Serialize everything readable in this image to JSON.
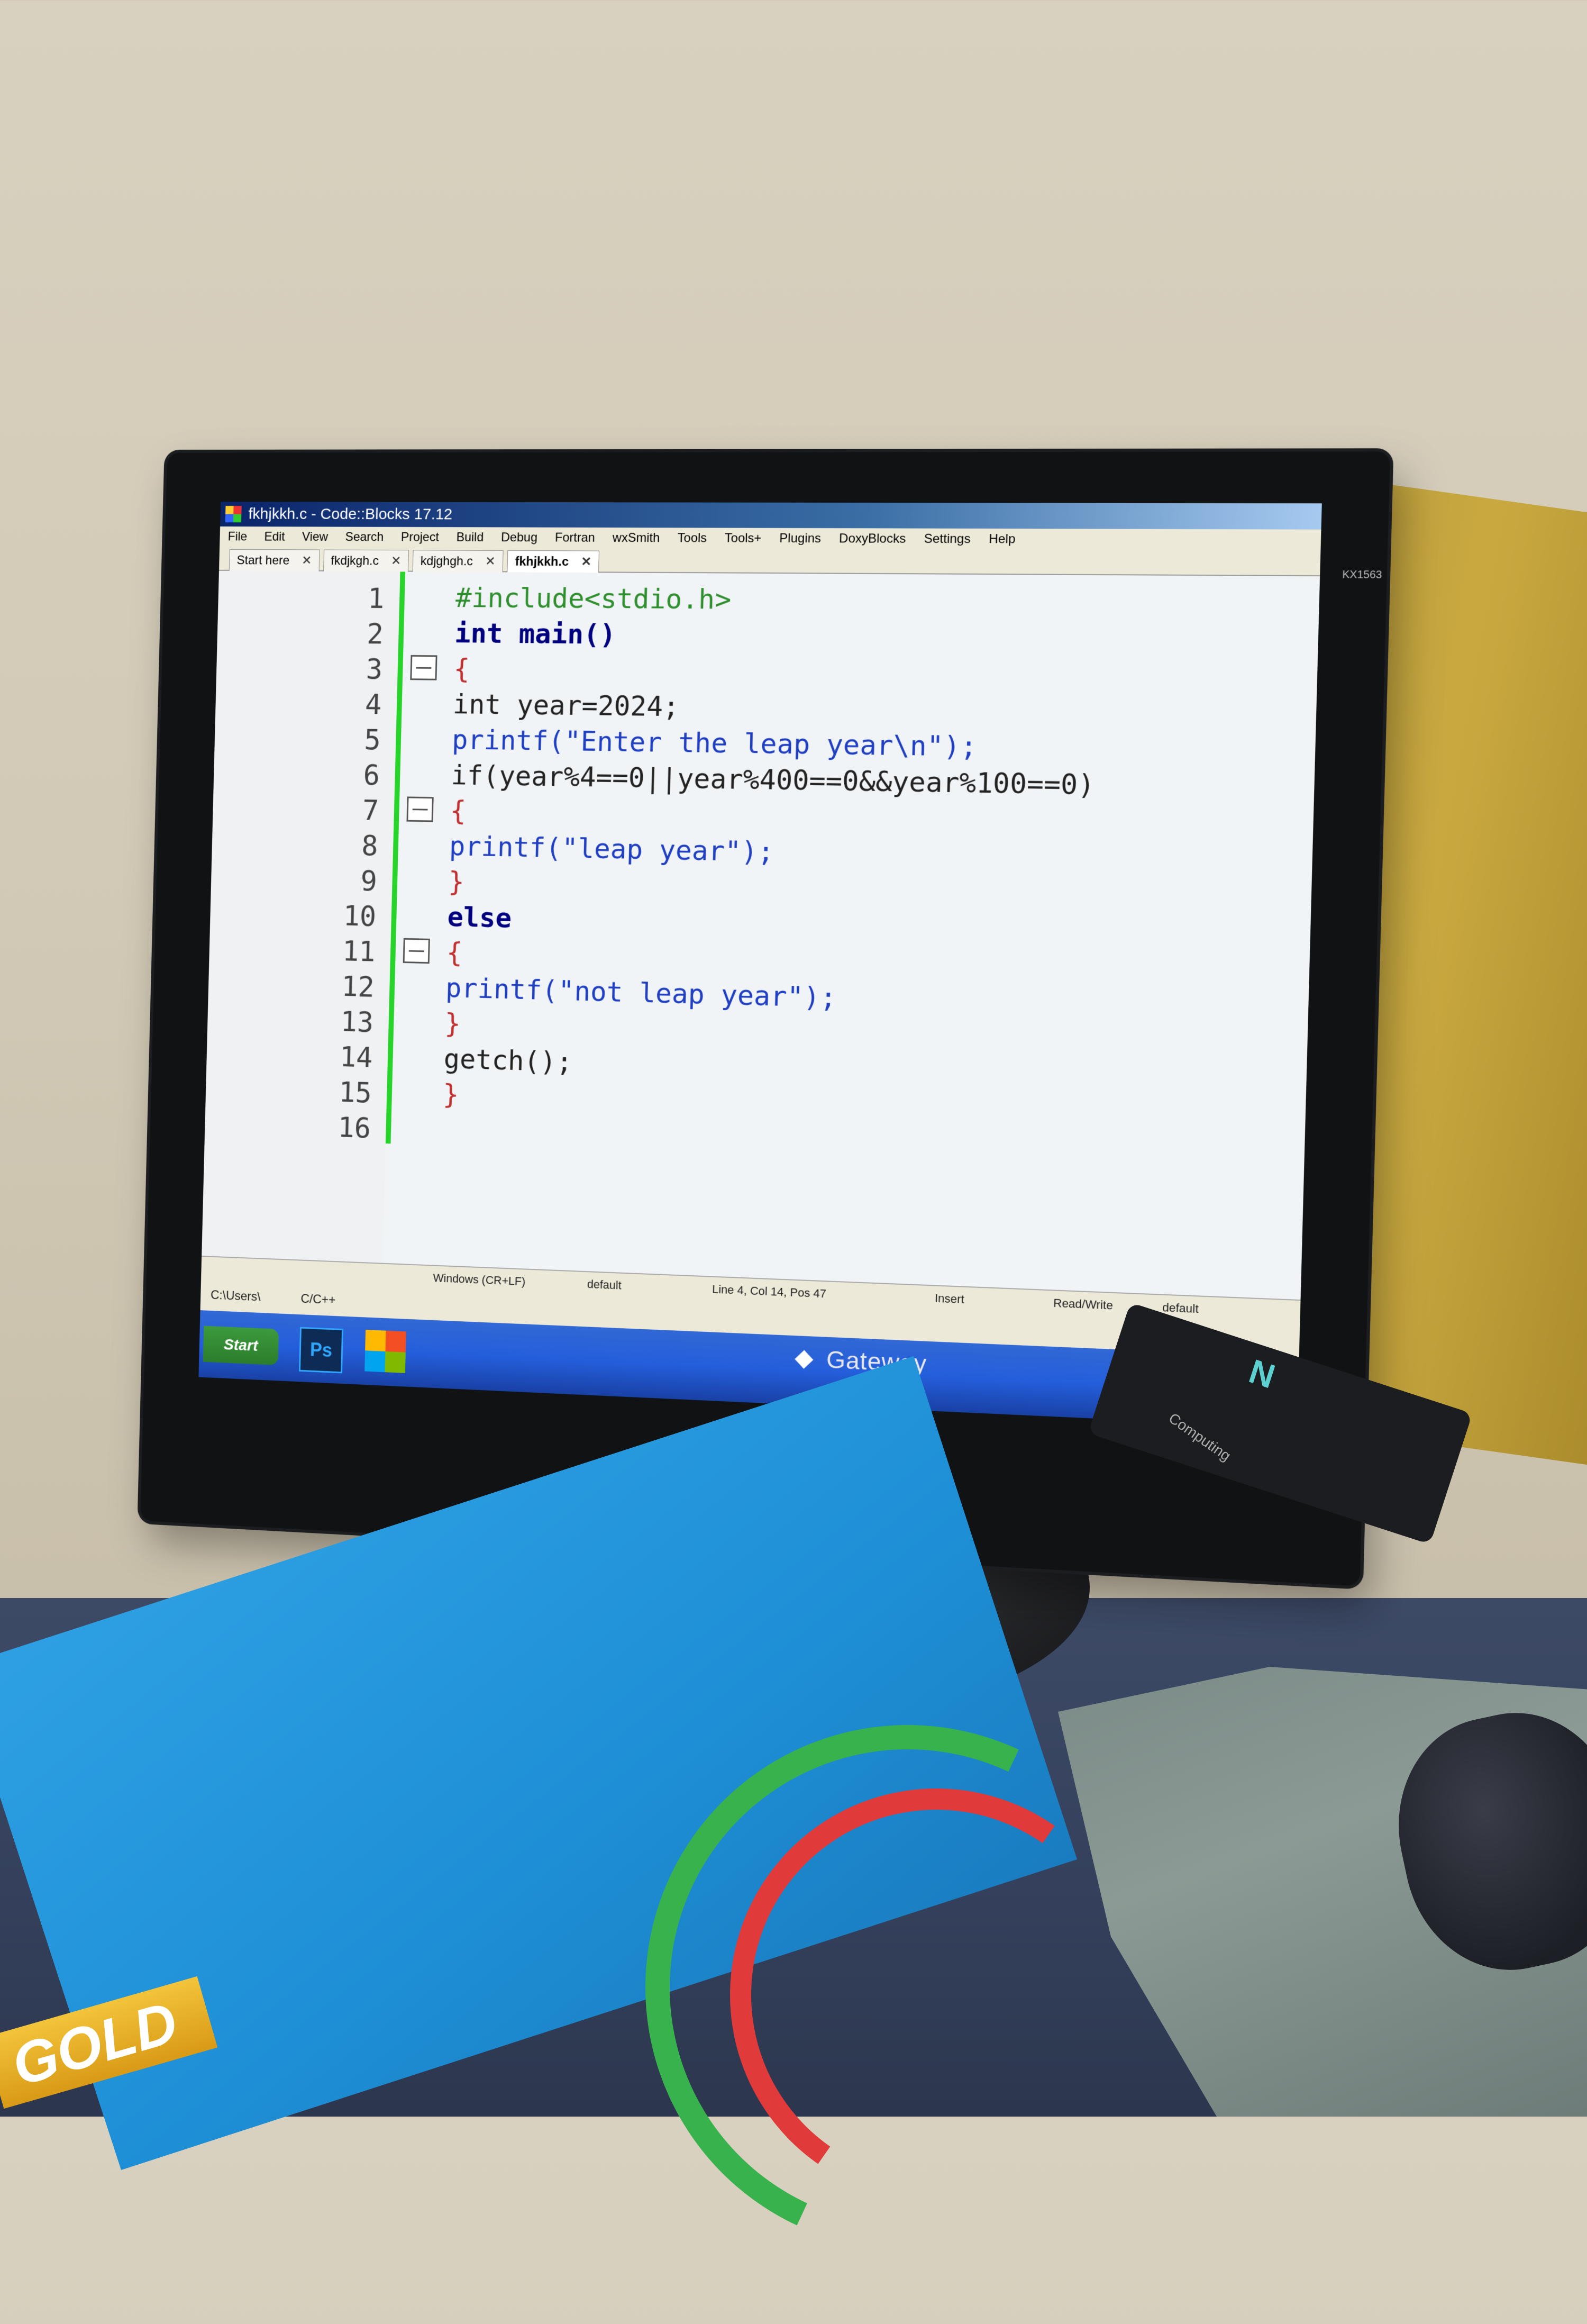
{
  "window": {
    "title": "fkhjkkh.c - Code::Blocks 17.12"
  },
  "menu": [
    "File",
    "Edit",
    "View",
    "Search",
    "Project",
    "Build",
    "Debug",
    "Fortran",
    "wxSmith",
    "Tools",
    "Tools+",
    "Plugins",
    "DoxyBlocks",
    "Settings",
    "Help"
  ],
  "tabs": [
    {
      "label": "Start here",
      "active": false
    },
    {
      "label": "fkdjkgh.c",
      "active": false
    },
    {
      "label": "kdjghgh.c",
      "active": false
    },
    {
      "label": "fkhjkkh.c",
      "active": true
    }
  ],
  "editor": {
    "line_numbers": [
      "1",
      "2",
      "3",
      "4",
      "5",
      "6",
      "7",
      "8",
      "9",
      "10",
      "11",
      "12",
      "13",
      "14",
      "15",
      "16"
    ],
    "lines": [
      "#include<stdio.h>",
      "int main()",
      "{",
      "int year=2024;",
      "printf(\"Enter the leap year\\n\");",
      "if(year%4==0||year%400==0&&year%100==0)",
      "{",
      "printf(\"leap year\");",
      "}",
      "else",
      "{",
      "printf(\"not leap year\");",
      "}",
      "getch();",
      "}",
      ""
    ]
  },
  "statusbar": {
    "eol": "Windows (CR+LF)",
    "encoding": "default",
    "position": "Line 4, Col 14, Pos 47",
    "mode": "Insert",
    "rw": "Read/Write",
    "profile": "default"
  },
  "logbar": {
    "path": "C:\\Users\\",
    "lang": "C/C++"
  },
  "taskbar": {
    "start_label": "Start",
    "ps_label": "Ps"
  },
  "monitor": {
    "brand": "Gateway",
    "model": "KX1563"
  },
  "device": {
    "label": "Computing"
  },
  "book": {
    "tag": "GOLD"
  },
  "colors": {
    "keyword": "#00007f",
    "preprocessor": "#2f8f2f",
    "string": "#1f3fc0",
    "operator": "#c03030",
    "change_bar": "#27d42a"
  }
}
